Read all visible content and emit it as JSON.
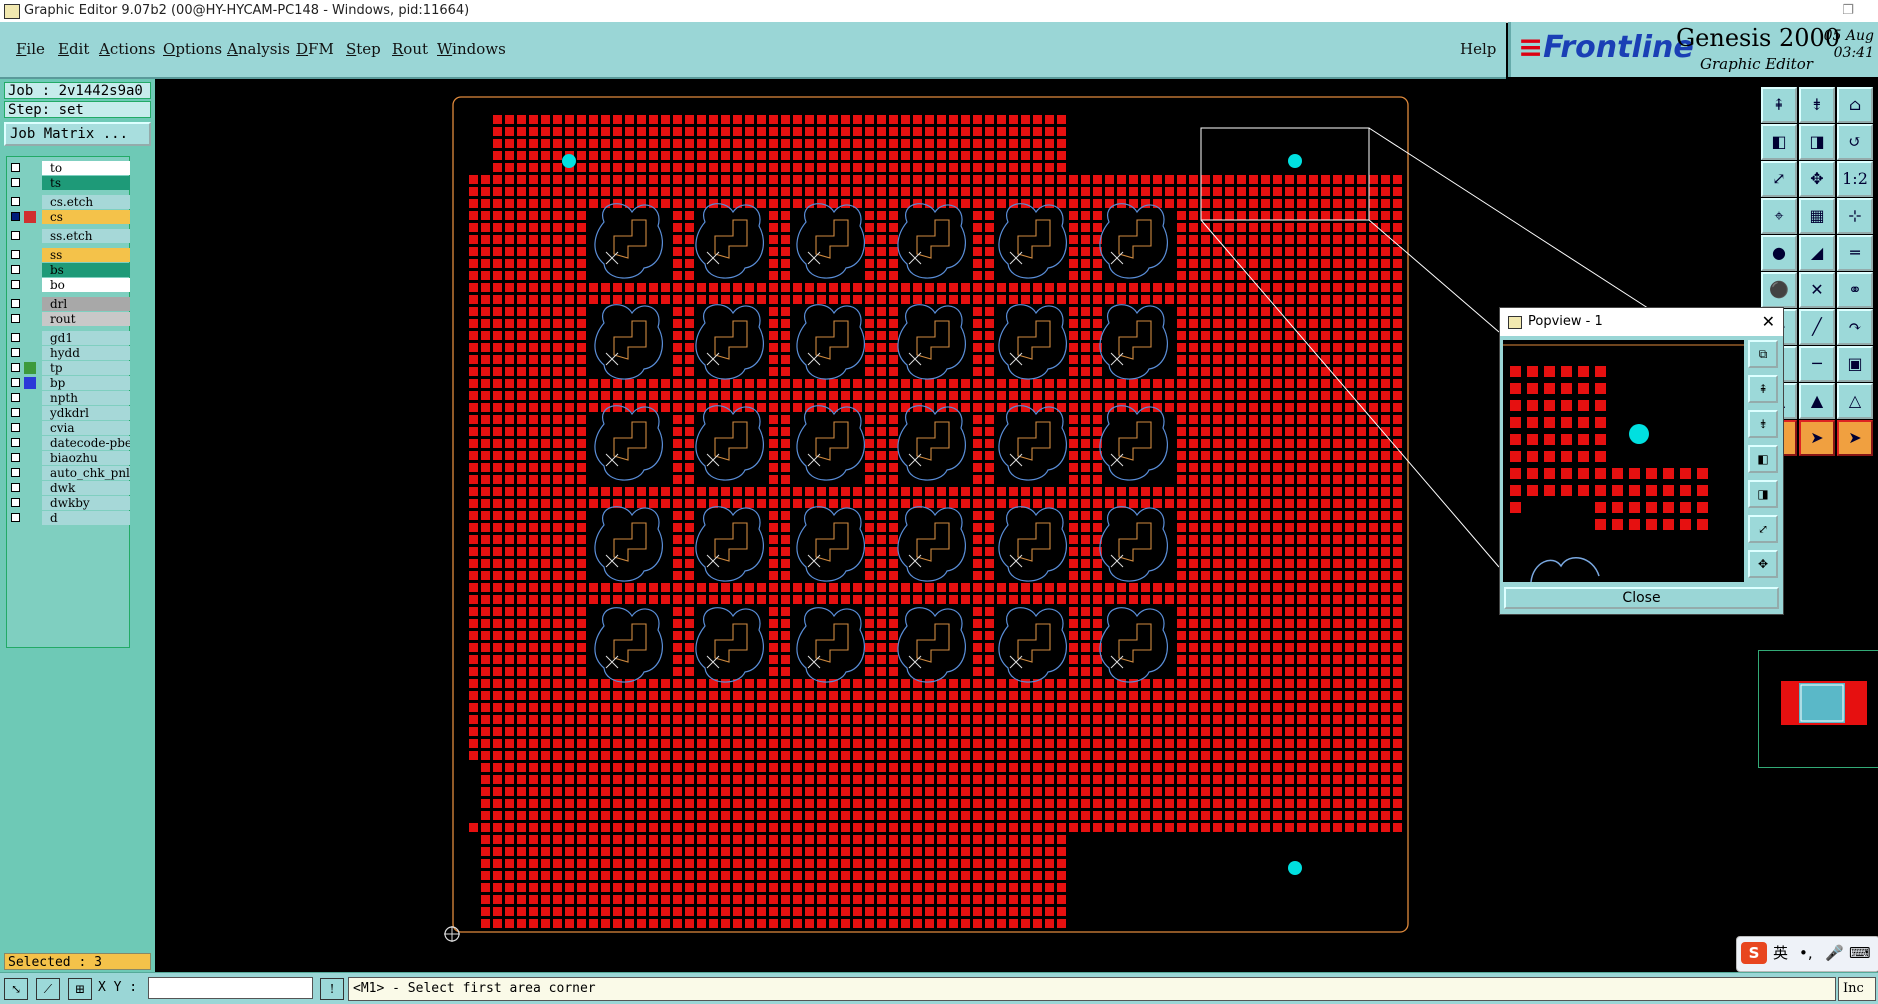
{
  "window": {
    "title": "Graphic Editor 9.07b2 (00@HY-HYCAM-PC148 - Windows, pid:11664)",
    "restore_glyph": "❐"
  },
  "menubar": {
    "items": [
      {
        "first": "F",
        "rest": "ile"
      },
      {
        "first": "E",
        "rest": "dit"
      },
      {
        "first": "A",
        "rest": "ctions"
      },
      {
        "first": "O",
        "rest": "ptions"
      },
      {
        "first": "A",
        "rest": "nalysis"
      },
      {
        "first": "D",
        "rest": "FM"
      },
      {
        "first": "S",
        "rest": "tep"
      },
      {
        "first": "R",
        "rest": "out"
      },
      {
        "first": "W",
        "rest": "indows"
      }
    ],
    "help": "Help"
  },
  "branding": {
    "logo_text": "Frontline",
    "product": "Genesis 2000",
    "subtitle": "Graphic Editor",
    "date_line1": "05 Aug",
    "date_line2": "03:41"
  },
  "job": {
    "job_label": "Job : 2v1442s9a0",
    "step_label": "Step: set",
    "matrix_button": "Job Matrix ..."
  },
  "layers": [
    {
      "name": "to",
      "color": "#ffffff",
      "active": false,
      "swatch": null
    },
    {
      "name": "ts",
      "color": "#1e9a78",
      "active": false,
      "swatch": null
    },
    {
      "name": "cs.etch",
      "color": "#a6d8d8",
      "active": false,
      "swatch": null
    },
    {
      "name": "cs",
      "color": "#f4c24a",
      "active": true,
      "swatch": "#d03030"
    },
    {
      "name": "ss.etch",
      "color": "#a6d8d8",
      "active": false,
      "swatch": null
    },
    {
      "name": "ss",
      "color": "#f4c24a",
      "active": false,
      "swatch": null
    },
    {
      "name": "bs",
      "color": "#1e9a78",
      "active": false,
      "swatch": null
    },
    {
      "name": "bo",
      "color": "#ffffff",
      "active": false,
      "swatch": null
    },
    {
      "name": "drl",
      "color": "#a8a8a8",
      "active": false,
      "swatch": null
    },
    {
      "name": "rout",
      "color": "#c8c8c8",
      "active": false,
      "swatch": null
    },
    {
      "name": "gd1",
      "color": "#a6d8d8",
      "active": false,
      "swatch": null
    },
    {
      "name": "hydd",
      "color": "#a6d8d8",
      "active": false,
      "swatch": null
    },
    {
      "name": "tp",
      "color": "#a6d8d8",
      "active": false,
      "swatch": "#3c9a3c"
    },
    {
      "name": "bp",
      "color": "#a6d8d8",
      "active": false,
      "swatch": "#2a3ad8"
    },
    {
      "name": "npth",
      "color": "#a6d8d8",
      "active": false,
      "swatch": null
    },
    {
      "name": "ydkdrl",
      "color": "#a6d8d8",
      "active": false,
      "swatch": null
    },
    {
      "name": "cvia",
      "color": "#a6d8d8",
      "active": false,
      "swatch": null
    },
    {
      "name": "datecode-pbe",
      "color": "#a6d8d8",
      "active": false,
      "swatch": null
    },
    {
      "name": "biaozhu",
      "color": "#a6d8d8",
      "active": false,
      "swatch": null
    },
    {
      "name": "auto_chk_pnl",
      "color": "#a6d8d8",
      "active": false,
      "swatch": null
    },
    {
      "name": "dwk",
      "color": "#a6d8d8",
      "active": false,
      "swatch": null
    },
    {
      "name": "dwkby",
      "color": "#a6d8d8",
      "active": false,
      "swatch": null
    },
    {
      "name": "d",
      "color": "#a6d8d8",
      "active": false,
      "swatch": null
    }
  ],
  "selection": {
    "label": "Selected : 3"
  },
  "popview": {
    "title": "Popview - 1",
    "close_button": "Close",
    "close_glyph": "✕"
  },
  "status": {
    "xy_label": "X Y :",
    "xy_value": "",
    "prompt": "<M1> - Select first area corner",
    "unit": "Inc",
    "exclaim": "!"
  },
  "ime": {
    "logo": "S",
    "lang": "英"
  },
  "colors": {
    "pad": "#e61010",
    "fiducial": "#00e0e0",
    "profile": "#e08a3c",
    "outline_blue": "#5a8ed8",
    "outline_orange": "#d08a40",
    "toolbar": "#9cd9d9",
    "panel": "#6ec9b6"
  },
  "toolbar_icons": [
    "home-up-icon",
    "home-down-icon",
    "home-icon",
    "pan-left-icon",
    "pan-right-icon",
    "zoom-back-icon",
    "fit-screen-icon",
    "zoom-pan-icon",
    "scale-1to2-icon",
    "measure-icon",
    "grid-icon",
    "snap-icon",
    "feature-icon",
    "line-icon",
    "ruler-icon",
    "pad-icon",
    "cross-icon",
    "link-icon",
    "arc-icon",
    "slash-icon",
    "undo-icon",
    "corner-icon",
    "minus-icon",
    "box-icon",
    "triangle-icon",
    "triangle-a-icon",
    "triangle-b-icon",
    "select-icon",
    "pointer-icon",
    "pointer-alt-icon"
  ],
  "popview_icons": [
    "pop-expand-icon",
    "pop-up-icon",
    "pop-down-icon",
    "pop-left-icon",
    "pop-right-icon",
    "pop-fit-icon",
    "pop-zoom-icon"
  ]
}
